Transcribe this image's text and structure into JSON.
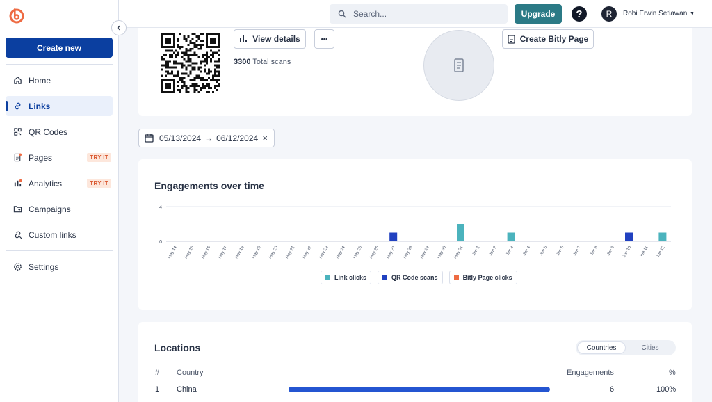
{
  "sidebar": {
    "create_label": "Create new",
    "items": [
      {
        "label": "Home",
        "icon": "home-icon"
      },
      {
        "label": "Links",
        "icon": "link-icon",
        "active": true
      },
      {
        "label": "QR Codes",
        "icon": "qr-code-icon"
      },
      {
        "label": "Pages",
        "icon": "page-icon",
        "badge": "TRY IT"
      },
      {
        "label": "Analytics",
        "icon": "analytics-icon",
        "badge": "TRY IT"
      },
      {
        "label": "Campaigns",
        "icon": "campaign-icon"
      },
      {
        "label": "Custom links",
        "icon": "custom-link-icon"
      }
    ],
    "settings_label": "Settings"
  },
  "topbar": {
    "search_placeholder": "Search...",
    "upgrade_label": "Upgrade",
    "help_label": "?",
    "avatar_initial": "R",
    "user_name": "Robi Erwin Setiawan"
  },
  "qr_card": {
    "view_details_label": "View details",
    "more_label": "•••",
    "total_scans_value": "3300",
    "total_scans_label": "Total scans",
    "create_page_label": "Create Bitly Page"
  },
  "date_range": {
    "start": "05/13/2024",
    "arrow": "→",
    "end": "06/12/2024",
    "clear": "×"
  },
  "engagements": {
    "title": "Engagements over time",
    "legend": [
      {
        "label": "Link clicks",
        "color": "#4bb3bd"
      },
      {
        "label": "QR Code scans",
        "color": "#2141c0"
      },
      {
        "label": "Bitly Page clicks",
        "color": "#ee6b43"
      }
    ]
  },
  "chart_data": {
    "type": "bar",
    "title": "Engagements over time",
    "categories": [
      "May 14",
      "May 15",
      "May 16",
      "May 17",
      "May 18",
      "May 19",
      "May 20",
      "May 21",
      "May 22",
      "May 23",
      "May 24",
      "May 25",
      "May 26",
      "May 27",
      "May 28",
      "May 29",
      "May 30",
      "May 31",
      "Jun 1",
      "Jun 2",
      "Jun 3",
      "Jun 4",
      "Jun 5",
      "Jun 6",
      "Jun 7",
      "Jun 8",
      "Jun 9",
      "Jun 10",
      "Jun 11",
      "Jun 12"
    ],
    "series": [
      {
        "name": "Link clicks",
        "color": "#4bb3bd",
        "values": [
          0,
          0,
          0,
          0,
          0,
          0,
          0,
          0,
          0,
          0,
          0,
          0,
          0,
          0,
          0,
          0,
          0,
          2,
          0,
          0,
          1,
          0,
          0,
          0,
          0,
          0,
          0,
          0,
          0,
          1
        ]
      },
      {
        "name": "QR Code scans",
        "color": "#2141c0",
        "values": [
          0,
          0,
          0,
          0,
          0,
          0,
          0,
          0,
          0,
          0,
          0,
          0,
          0,
          1,
          0,
          0,
          0,
          0,
          0,
          0,
          0,
          0,
          0,
          0,
          0,
          0,
          0,
          1,
          0,
          0
        ]
      },
      {
        "name": "Bitly Page clicks",
        "color": "#ee6b43",
        "values": [
          0,
          0,
          0,
          0,
          0,
          0,
          0,
          0,
          0,
          0,
          0,
          0,
          0,
          0,
          0,
          0,
          0,
          0,
          0,
          0,
          0,
          0,
          0,
          0,
          0,
          0,
          0,
          0,
          0,
          0
        ]
      }
    ],
    "yticks": [
      "0",
      "4"
    ],
    "ylim": [
      0,
      4
    ],
    "grid": true,
    "legend_position": "bottom"
  },
  "locations": {
    "title": "Locations",
    "tabs": [
      "Countries",
      "Cities"
    ],
    "headers": {
      "num": "#",
      "country": "Country",
      "engagements": "Engagements",
      "pct": "%"
    },
    "rows": [
      {
        "rank": "1",
        "country": "China",
        "share": 1.0,
        "engagements": "6",
        "pct": "100%"
      }
    ]
  }
}
